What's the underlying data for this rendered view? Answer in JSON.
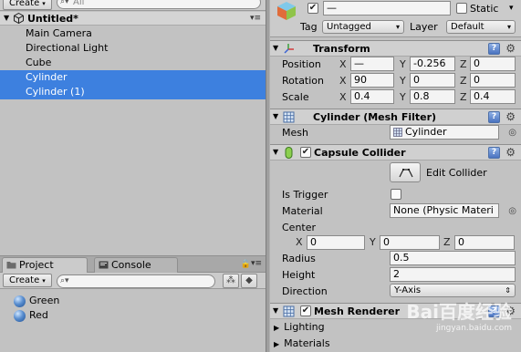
{
  "hierarchy": {
    "create_label": "Create",
    "search_placeholder": "All",
    "scene_title": "Untitled*",
    "items": [
      {
        "label": "Main Camera",
        "selected": false
      },
      {
        "label": "Directional Light",
        "selected": false
      },
      {
        "label": "Cube",
        "selected": false
      },
      {
        "label": "Cylinder",
        "selected": true
      },
      {
        "label": "Cylinder (1)",
        "selected": true
      }
    ]
  },
  "project": {
    "tabs": [
      {
        "label": "Project",
        "icon": "folder-icon",
        "active": true
      },
      {
        "label": "Console",
        "icon": "console-icon",
        "active": false
      }
    ],
    "create_label": "Create",
    "assets": [
      {
        "label": "Green",
        "icon": "material-sphere-icon"
      },
      {
        "label": "Red",
        "icon": "material-sphere-icon"
      }
    ]
  },
  "inspector": {
    "object": {
      "active": true,
      "name": "—",
      "static_label": "Static",
      "static_checked": false,
      "tag_label": "Tag",
      "tag_value": "Untagged",
      "layer_label": "Layer",
      "layer_value": "Default"
    },
    "transform": {
      "title": "Transform",
      "rows": [
        {
          "label": "Position",
          "x": "—",
          "y": "-0.256",
          "z": "0"
        },
        {
          "label": "Rotation",
          "x": "90",
          "y": "0",
          "z": "0"
        },
        {
          "label": "Scale",
          "x": "0.4",
          "y": "0.8",
          "z": "0.4"
        }
      ]
    },
    "mesh_filter": {
      "title": "Cylinder (Mesh Filter)",
      "mesh_label": "Mesh",
      "mesh_value": "Cylinder"
    },
    "capsule_collider": {
      "title": "Capsule Collider",
      "enabled": true,
      "edit_label": "Edit Collider",
      "is_trigger_label": "Is Trigger",
      "is_trigger_checked": false,
      "material_label": "Material",
      "material_value": "None (Physic Materi",
      "center_label": "Center",
      "center": {
        "x": "0",
        "y": "0",
        "z": "0"
      },
      "radius_label": "Radius",
      "radius_value": "0.5",
      "height_label": "Height",
      "height_value": "2",
      "direction_label": "Direction",
      "direction_value": "Y-Axis"
    },
    "mesh_renderer": {
      "title": "Mesh Renderer",
      "enabled": true,
      "lighting_label": "Lighting",
      "materials_label": "Materials"
    }
  },
  "axis_labels": {
    "x": "X",
    "y": "Y",
    "z": "Z"
  },
  "watermark": {
    "text": "Bai百度经验",
    "sub": "jingyan.baidu.com"
  },
  "colors": {
    "selection": "#3d80df",
    "panel": "#c2c2c2",
    "header": "#cbcbcb"
  }
}
